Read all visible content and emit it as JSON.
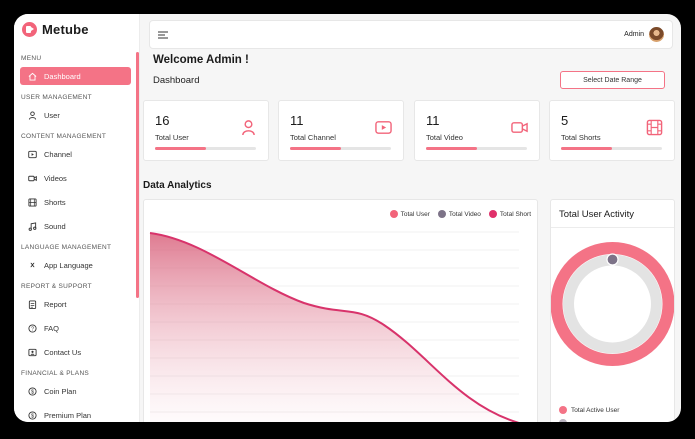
{
  "app": {
    "name": "Metube"
  },
  "sidebar": {
    "sections": [
      {
        "label": "MENU"
      },
      {
        "label": "USER MANAGEMENT"
      },
      {
        "label": "CONTENT MANAGEMENT"
      },
      {
        "label": "LANGUAGE MANAGEMENT"
      },
      {
        "label": "REPORT & SUPPORT"
      },
      {
        "label": "FINANCIAL & PLANS"
      }
    ],
    "items": [
      {
        "label": "Dashboard",
        "icon": "home-icon",
        "active": true
      },
      {
        "label": "User",
        "icon": "user-icon"
      },
      {
        "label": "Channel",
        "icon": "play-square-icon"
      },
      {
        "label": "Videos",
        "icon": "video-camera-icon"
      },
      {
        "label": "Shorts",
        "icon": "film-icon"
      },
      {
        "label": "Sound",
        "icon": "music-note-icon"
      },
      {
        "label": "App Language",
        "icon": "translate-icon"
      },
      {
        "label": "Report",
        "icon": "report-icon"
      },
      {
        "label": "FAQ",
        "icon": "question-circle-icon"
      },
      {
        "label": "Contact Us",
        "icon": "contact-card-icon"
      },
      {
        "label": "Coin Plan",
        "icon": "dollar-circle-icon"
      },
      {
        "label": "Premium Plan",
        "icon": "dollar-circle-icon"
      }
    ]
  },
  "header": {
    "user": "Admin",
    "menu_icon": "hamburger-menu-icon"
  },
  "main": {
    "welcome": "Welcome Admin !",
    "title": "Dashboard",
    "date_button": "Select Date Range",
    "cards": [
      {
        "value": "16",
        "label": "Total User",
        "icon": "user-icon",
        "progress": 0.5
      },
      {
        "value": "11",
        "label": "Total Channel",
        "icon": "play-square-icon",
        "progress": 0.5
      },
      {
        "value": "11",
        "label": "Total Video",
        "icon": "video-camera-icon",
        "progress": 0.5
      },
      {
        "value": "5",
        "label": "Total Shorts",
        "icon": "film-icon",
        "progress": 0.5
      }
    ],
    "analytics_title": "Data Analytics",
    "activity_title": "Total User Activity"
  },
  "colors": {
    "accent": "#f47386",
    "video": "#7d7388",
    "short": "#e0306a"
  },
  "chart_data": {
    "type": "area",
    "title": "",
    "xlabel": "",
    "ylabel": "",
    "legend_position": "top-right",
    "grid": true,
    "series": [
      {
        "name": "Total User",
        "color": "#f2647a"
      },
      {
        "name": "Total Video",
        "color": "#7d7388"
      },
      {
        "name": "Total Short",
        "color": "#e0306a"
      }
    ]
  },
  "activity_chart": {
    "type": "donut",
    "legend": [
      {
        "name": "Total Active User",
        "color": "#f47386"
      }
    ]
  }
}
